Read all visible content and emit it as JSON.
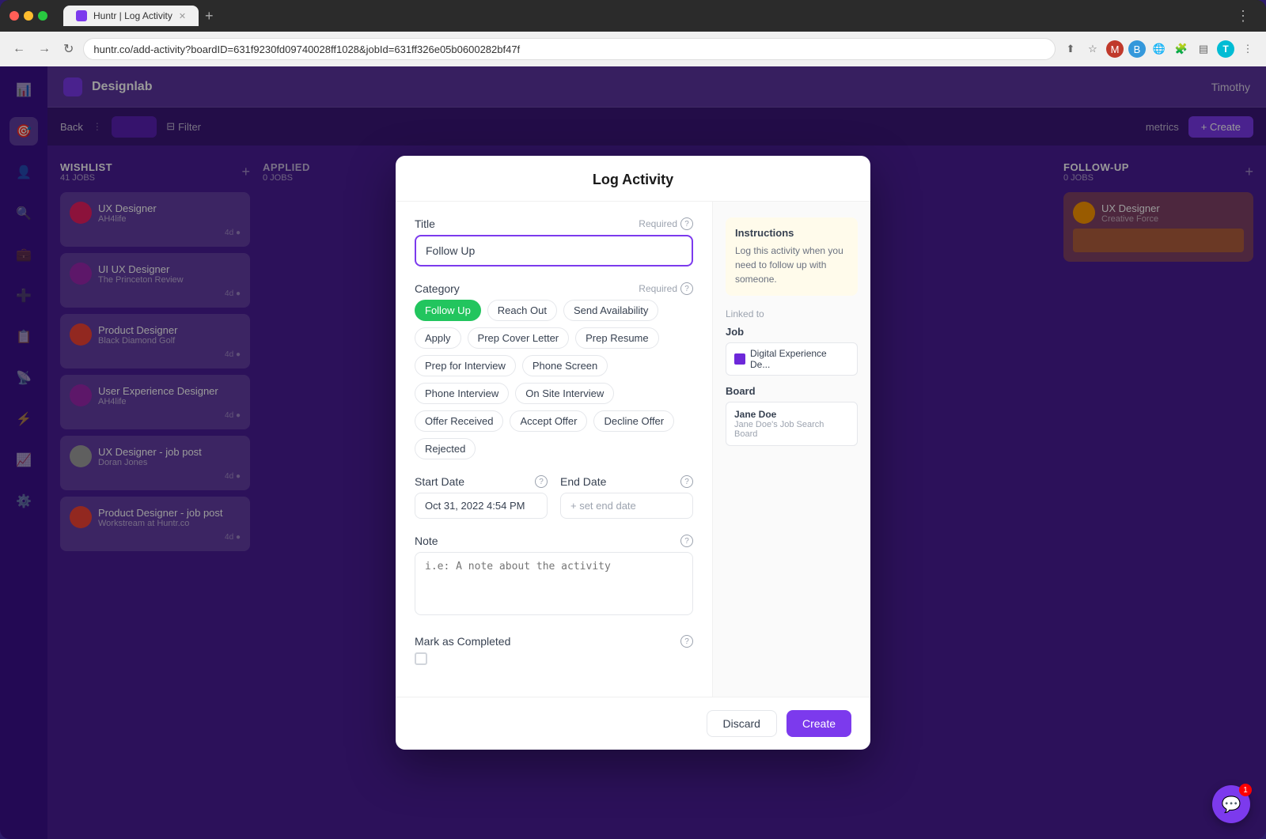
{
  "browser": {
    "url": "huntr.co/add-activity?boardID=631f9230fd09740028ff1028&jobId=631ff326e05b0600282bf47f",
    "tab_title": "Huntr | Log Activity",
    "nav_back": "←",
    "nav_forward": "→",
    "nav_refresh": "↻"
  },
  "app": {
    "name": "Designlab",
    "user": "Timothy"
  },
  "board": {
    "back_label": "Back",
    "filter_label": "Filter",
    "metrics_label": "metrics",
    "create_label": "+ Create"
  },
  "columns": [
    {
      "title": "WISHLIST",
      "count": "41 JOBS",
      "cards": [
        {
          "title": "UX Designer",
          "company": "AH4life",
          "date": "4d",
          "avatar_color": "#e91e63"
        },
        {
          "title": "UI UX Designer",
          "company": "The Princeton Review",
          "date": "4d",
          "avatar_color": "#9c27b0"
        },
        {
          "title": "Product Designer",
          "company": "Black Diamond Golf",
          "date": "4d",
          "avatar_color": "#f44336"
        },
        {
          "title": "User Experience Designer",
          "company": "AH4life",
          "date": "4d",
          "avatar_color": "#9c27b0"
        },
        {
          "title": "UX Designer - job post",
          "company": "Doran Jones",
          "date": "4d",
          "avatar_color": "#9e9e9e"
        },
        {
          "title": "Product Designer - job post",
          "company": "Workstream at Huntr.co",
          "date": "4d",
          "avatar_color": "#f44336"
        }
      ]
    },
    {
      "title": "FOLLOW-UP",
      "count": "0 JOBS",
      "cards": [
        {
          "title": "UX Designer",
          "company": "Creative Force",
          "date": "",
          "avatar_color": "#ff9800"
        }
      ]
    }
  ],
  "modal": {
    "title": "Log Activity",
    "title_label": "Title",
    "title_required": "Required",
    "title_placeholder": "Follow Up",
    "title_value": "Follow Up",
    "category_label": "Category",
    "category_required": "Required",
    "categories": [
      {
        "id": "follow-up",
        "label": "Follow Up",
        "active": true
      },
      {
        "id": "reach-out",
        "label": "Reach Out",
        "active": false
      },
      {
        "id": "send-availability",
        "label": "Send Availability",
        "active": false
      },
      {
        "id": "apply",
        "label": "Apply",
        "active": false
      },
      {
        "id": "prep-cover-letter",
        "label": "Prep Cover Letter",
        "active": false
      },
      {
        "id": "prep-resume",
        "label": "Prep Resume",
        "active": false
      },
      {
        "id": "prep-for-interview",
        "label": "Prep for Interview",
        "active": false
      },
      {
        "id": "phone-screen",
        "label": "Phone Screen",
        "active": false
      },
      {
        "id": "phone-interview",
        "label": "Phone Interview",
        "active": false
      },
      {
        "id": "on-site-interview",
        "label": "On Site Interview",
        "active": false
      },
      {
        "id": "offer-received",
        "label": "Offer Received",
        "active": false
      },
      {
        "id": "accept-offer",
        "label": "Accept Offer",
        "active": false
      },
      {
        "id": "decline-offer",
        "label": "Decline Offer",
        "active": false
      },
      {
        "id": "rejected",
        "label": "Rejected",
        "active": false
      }
    ],
    "start_date_label": "Start Date",
    "start_date_value": "Oct 31, 2022 4:54 PM",
    "end_date_label": "End Date",
    "end_date_placeholder": "+ set end date",
    "note_label": "Note",
    "note_placeholder": "i.e: A note about the activity",
    "mark_completed_label": "Mark as Completed",
    "discard_label": "Discard",
    "create_label": "Create",
    "instructions_title": "Instructions",
    "instructions_text": "Log this activity when you need to follow up with someone.",
    "linked_to_label": "Linked to",
    "job_section_label": "Job",
    "job_name": "Digital Experience De...",
    "board_section_label": "Board",
    "board_name": "Jane Doe",
    "board_subtitle": "Jane Doe's Job Search Board"
  },
  "chat": {
    "badge": "1",
    "icon": "💬"
  },
  "sidebar": {
    "items": [
      {
        "icon": "📊",
        "name": "analytics",
        "active": false
      },
      {
        "icon": "🎯",
        "name": "target",
        "active": true
      },
      {
        "icon": "👤",
        "name": "profile",
        "active": false
      },
      {
        "icon": "🔍",
        "name": "search",
        "active": false
      },
      {
        "icon": "💼",
        "name": "jobs",
        "active": false
      },
      {
        "icon": "➕",
        "name": "add",
        "active": false
      },
      {
        "icon": "📋",
        "name": "boards",
        "active": false
      },
      {
        "icon": "📡",
        "name": "feed",
        "active": false
      },
      {
        "icon": "⚡",
        "name": "activity",
        "active": false
      },
      {
        "icon": "📈",
        "name": "stats",
        "active": false
      },
      {
        "icon": "⚙️",
        "name": "settings",
        "active": false
      }
    ]
  }
}
